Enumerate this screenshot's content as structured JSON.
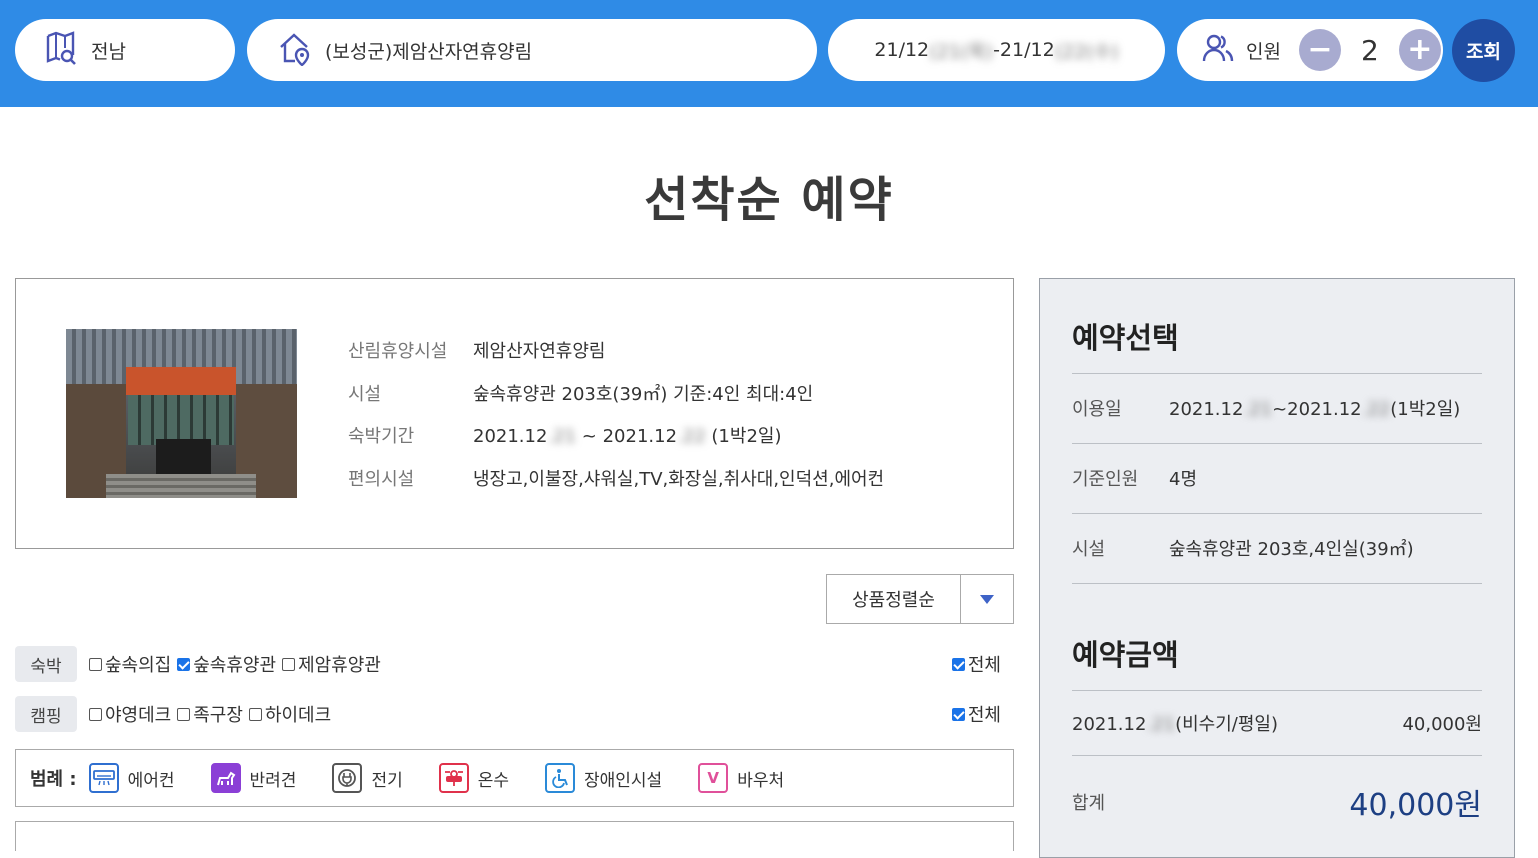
{
  "search": {
    "region": "전남",
    "forest": "(보성군)제암산자연휴양림",
    "date_start": "21/12",
    "date_start_hidden": "(21(목)",
    "date_mid": "-21/12",
    "date_end_hidden": "(22(수)",
    "people_label": "인원",
    "people_minus": "−",
    "people_count": "2",
    "people_plus": "+",
    "submit": "조회"
  },
  "page_title": "선착순 예약",
  "facility_info": {
    "rows": [
      {
        "label": "산림휴양시설",
        "value": "제암산자연휴양림"
      },
      {
        "label": "시설",
        "value": "숲속휴양관 203호(39㎡) 기준:4인 최대:4인"
      },
      {
        "label": "숙박기간",
        "value_prefix": "2021.12",
        "value_hidden1": ".21",
        "value_mid": " ~ 2021.12",
        "value_hidden2": ".22",
        "value_suffix": " (1박2일)"
      },
      {
        "label": "편의시설",
        "value": "냉장고,이불장,샤워실,TV,화장실,취사대,인덕션,에어컨"
      }
    ]
  },
  "sort": {
    "selected": "상품정렬순"
  },
  "filters": {
    "lodging": {
      "tag": "숙박",
      "options": [
        {
          "label": "숲속의집",
          "checked": false
        },
        {
          "label": "숲속휴양관",
          "checked": true
        },
        {
          "label": "제암휴양관",
          "checked": false
        }
      ],
      "all_label": "전체",
      "all_checked": true
    },
    "camping": {
      "tag": "캠핑",
      "options": [
        {
          "label": "야영데크",
          "checked": false
        },
        {
          "label": "족구장",
          "checked": false
        },
        {
          "label": "하이데크",
          "checked": false
        }
      ],
      "all_label": "전체",
      "all_checked": true
    }
  },
  "legend": {
    "title": "범례 :",
    "items": [
      {
        "label": "에어컨",
        "icon": "aircon-icon",
        "color": "#2f6fd0"
      },
      {
        "label": "반려견",
        "icon": "pet-icon",
        "color": "#8b3fd6"
      },
      {
        "label": "전기",
        "icon": "plug-icon",
        "color": "#555555"
      },
      {
        "label": "온수",
        "icon": "hot-water-icon",
        "color": "#e0314b"
      },
      {
        "label": "장애인시설",
        "icon": "wheelchair-icon",
        "color": "#2a8ad8"
      },
      {
        "label": "바우처",
        "icon": "voucher-icon",
        "color": "#e0509a",
        "glyph": "V"
      }
    ]
  },
  "panel": {
    "select_title": "예약선택",
    "rows": [
      {
        "label": "이용일",
        "value_prefix": "2021.12",
        "value_hidden1": ".21",
        "value_mid": "~2021.12",
        "value_hidden2": ".22",
        "value_suffix": "(1박2일)"
      },
      {
        "label": "기준인원",
        "value": "4명"
      },
      {
        "label": "시설",
        "value": "숲속휴양관 203호,4인실(39㎡)"
      }
    ],
    "amount_title": "예약금액",
    "price_row": {
      "date_prefix": "2021.12",
      "date_hidden": ".21",
      "desc": "(비수기/평일)",
      "amount": "40,000원"
    },
    "total_label": "합계",
    "total_amount": "40,000원"
  },
  "colors": {
    "topbar": "#2f8be6",
    "search_button": "#1f4da3",
    "accent": "#3e63c7",
    "total": "#1d3f83"
  }
}
